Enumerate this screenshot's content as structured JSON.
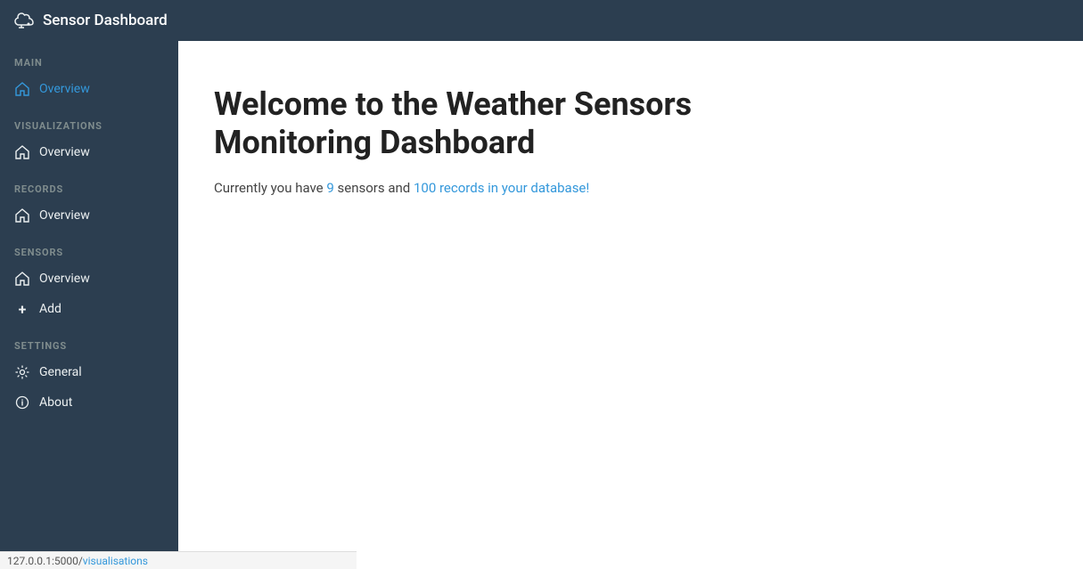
{
  "topbar": {
    "title": "Sensor Dashboard",
    "icon": "☁"
  },
  "sidebar": {
    "sections": [
      {
        "label": "MAIN",
        "items": [
          {
            "id": "main-overview",
            "text": "Overview",
            "icon": "home",
            "active": true
          }
        ]
      },
      {
        "label": "VISUALIZATIONS",
        "items": [
          {
            "id": "vis-overview",
            "text": "Overview",
            "icon": "home",
            "active": false
          }
        ]
      },
      {
        "label": "RECORDS",
        "items": [
          {
            "id": "records-overview",
            "text": "Overview",
            "icon": "home",
            "active": false
          }
        ]
      },
      {
        "label": "SENSORS",
        "items": [
          {
            "id": "sensors-overview",
            "text": "Overview",
            "icon": "home",
            "active": false
          },
          {
            "id": "sensors-add",
            "text": "Add",
            "icon": "plus",
            "active": false
          }
        ]
      },
      {
        "label": "SETTINGS",
        "items": [
          {
            "id": "settings-general",
            "text": "General",
            "icon": "gear",
            "active": false
          },
          {
            "id": "settings-about",
            "text": "About",
            "icon": "info",
            "active": false
          }
        ]
      }
    ]
  },
  "main": {
    "heading": "Welcome to the Weather Sensors Monitoring Dashboard",
    "subtext_prefix": "Currently you have ",
    "sensor_count": "9",
    "subtext_middle": " sensors and ",
    "record_count": "100",
    "subtext_suffix": " records in your database!"
  },
  "statusbar": {
    "url_base": "127.0.0.1:5000/",
    "url_path": "visualisations"
  }
}
